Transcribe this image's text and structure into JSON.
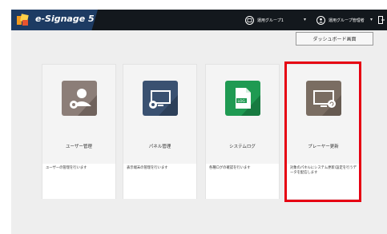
{
  "header": {
    "app_title": "e-Signage 5",
    "group_label": "運用グループ1",
    "user_label": "運用グループ管理者"
  },
  "toolbar": {
    "dashboard_button": "ダッシュボード画面"
  },
  "cards": [
    {
      "title": "ユーザー管理",
      "description": "ユーザーの管理を行います",
      "tile_color": "#8c7e78"
    },
    {
      "title": "パネル管理",
      "description": "表示端末の管理を行います",
      "tile_color": "#3a5171"
    },
    {
      "title": "システムログ",
      "description": "各種ログの確認を行います",
      "tile_color": "#1f9a52"
    },
    {
      "title": "プレーヤー更新",
      "description": "対象のパネルにシステム更新/設定を行うデータを配信します",
      "tile_color": "#7a6d62"
    }
  ],
  "colors": {
    "topbar": "#13181d",
    "brand": "#1d3b63",
    "highlight": "#e60012"
  }
}
